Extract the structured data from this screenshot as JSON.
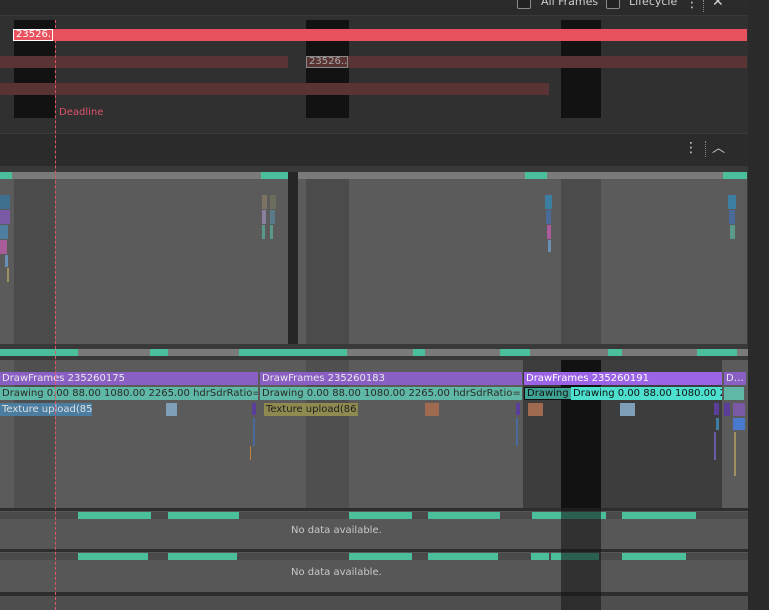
{
  "toolbar": {
    "all_frames_label": "All Frames",
    "lifecycle_label": "Lifecycle",
    "more_icon": "kebab-icon",
    "close_icon": "close-icon"
  },
  "frames_track": {
    "frame_label_1": "23526…",
    "frame_label_2": "23526…",
    "deadline_label": "Deadline",
    "colors": {
      "red": "#e8525e",
      "dark_red": "#5a3434",
      "deadline": "#e0556a"
    }
  },
  "section": {
    "more_icon": "kebab-icon",
    "collapse_icon": "chevron-up-icon"
  },
  "draw_frames": [
    {
      "title": "DrawFrames 235260175",
      "drawing": "Drawing  0.00  88.00  1080.00  2265.00  hdrSdrRatio=1…",
      "texture": "Texture upload(85…"
    },
    {
      "title": "DrawFrames 235260183",
      "drawing": "Drawing  0.00  88.00  1080.00  2265.00  hdrSdrRatio=…",
      "texture": "Texture upload(86…"
    },
    {
      "title": "DrawFrames 235260191",
      "drawing": "Drawing   0.00  88.00  1080.00  2265.00  …",
      "texture": ""
    },
    {
      "title": "D…",
      "drawing": "",
      "texture": ""
    }
  ],
  "tracks": {
    "no_data_1": "No data available.",
    "no_data_2": "No data available."
  }
}
